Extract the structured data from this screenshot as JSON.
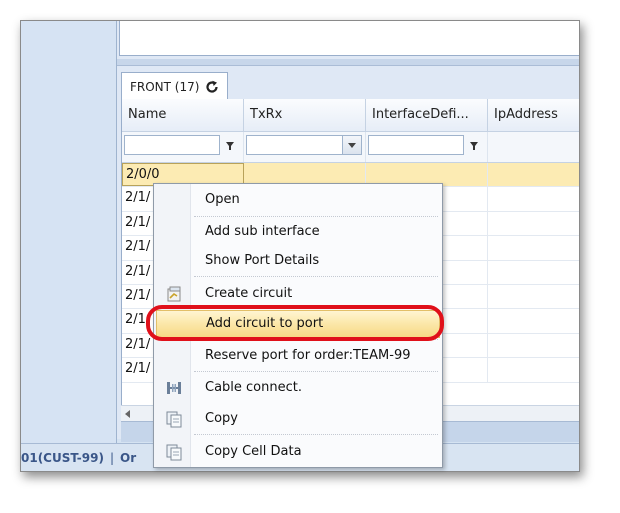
{
  "tab": {
    "label": "FRONT (17)"
  },
  "grid": {
    "columns": [
      {
        "label": "Name"
      },
      {
        "label": "TxRx"
      },
      {
        "label": "InterfaceDefi..."
      },
      {
        "label": "IpAddress"
      }
    ],
    "rows": [
      {
        "name": "2/0/0"
      },
      {
        "name": "2/1/"
      },
      {
        "name": "2/1/"
      },
      {
        "name": "2/1/"
      },
      {
        "name": "2/1/"
      },
      {
        "name": "2/1/"
      },
      {
        "name": "2/1/"
      },
      {
        "name": "2/1/"
      },
      {
        "name": "2/1/"
      }
    ]
  },
  "status_bar": {
    "left": "01(CUST-99)",
    "separator": "|",
    "right": "Or"
  },
  "context_menu": {
    "items": [
      {
        "label": "Open",
        "icon": ""
      },
      {
        "label": "Add sub interface",
        "icon": ""
      },
      {
        "label": "Show Port Details",
        "icon": ""
      },
      {
        "label": "Create circuit",
        "icon": "create-circuit-icon"
      },
      {
        "label": "Add circuit to port",
        "icon": ""
      },
      {
        "label": "Reserve port for order:TEAM-99",
        "icon": ""
      },
      {
        "label": "Cable connect.",
        "icon": "cable-connect-icon"
      },
      {
        "label": "Copy",
        "icon": "copy-icon"
      },
      {
        "label": "Copy Cell Data",
        "icon": "copy-icon"
      }
    ]
  },
  "colors": {
    "selected_row": "#fcebb3",
    "menu_highlight": "#fbe7a8",
    "annotation": "#e0101a",
    "status_text": "#3a5688"
  }
}
